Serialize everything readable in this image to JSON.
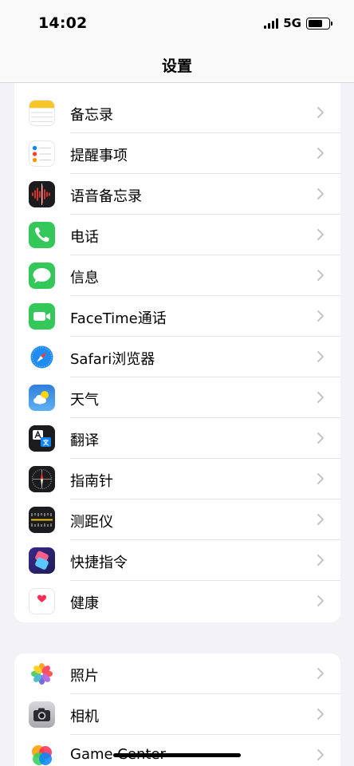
{
  "status": {
    "time": "14:02",
    "network": "5G"
  },
  "nav": {
    "title": "设置"
  },
  "group1": [
    {
      "label": "备忘录",
      "icon": "notes-icon"
    },
    {
      "label": "提醒事项",
      "icon": "reminders-icon"
    },
    {
      "label": "语音备忘录",
      "icon": "voice-memos-icon"
    },
    {
      "label": "电话",
      "icon": "phone-icon"
    },
    {
      "label": "信息",
      "icon": "messages-icon"
    },
    {
      "label": "FaceTime通话",
      "icon": "facetime-icon"
    },
    {
      "label": "Safari浏览器",
      "icon": "safari-icon"
    },
    {
      "label": "天气",
      "icon": "weather-icon"
    },
    {
      "label": "翻译",
      "icon": "translate-icon"
    },
    {
      "label": "指南针",
      "icon": "compass-icon"
    },
    {
      "label": "测距仪",
      "icon": "measure-icon"
    },
    {
      "label": "快捷指令",
      "icon": "shortcuts-icon"
    },
    {
      "label": "健康",
      "icon": "health-icon"
    }
  ],
  "group2": [
    {
      "label": "照片",
      "icon": "photos-icon"
    },
    {
      "label": "相机",
      "icon": "camera-icon"
    },
    {
      "label": "Game Center",
      "icon": "game-center-icon"
    }
  ]
}
